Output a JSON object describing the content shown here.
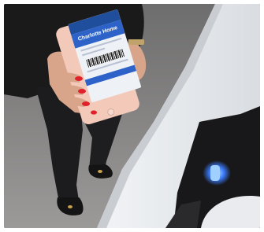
{
  "image": {
    "scene": "hand-holding-phone-boarding-pass-at-scanner",
    "colors": {
      "floor": "#8a8888",
      "trousers": "#1c1c1e",
      "jacket": "#1a1a1b",
      "skin": "#d9a58a",
      "nails": "#e0212b",
      "phone_body": "#f3c9b9",
      "phone_screen": "#2d63c8",
      "desk": "#e9ecef",
      "scanner": "#18181a",
      "scanner_light": "#3b7bff"
    }
  },
  "phone": {
    "app_header": "",
    "banner": "Charlotte Home"
  }
}
